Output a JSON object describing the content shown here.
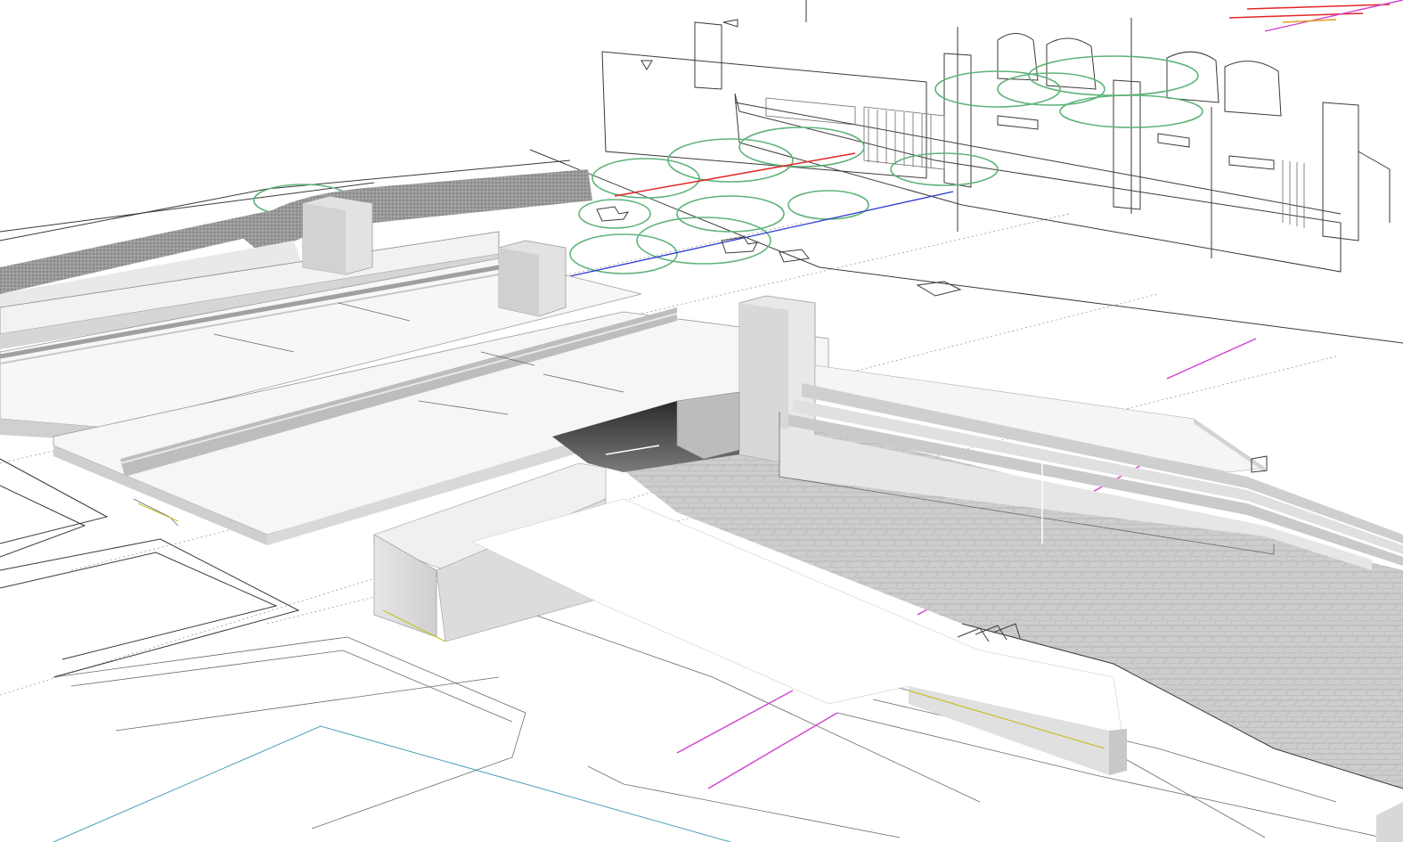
{
  "scene": {
    "colors": {
      "background": "#ffffff",
      "linework": "#3a3a3a",
      "solid_light": "#f4f4f4",
      "solid_mid": "#dcdcdc",
      "solid_dark": "#b8b8b8",
      "paving": "#c6c6c6",
      "vegetation": "#5fb37a",
      "magenta_line": "#d040d0",
      "red_line": "#e02828",
      "blue_line": "#2a3ad0",
      "teal_line": "#4aa0b8",
      "yellow_edge": "#c8c030"
    }
  }
}
